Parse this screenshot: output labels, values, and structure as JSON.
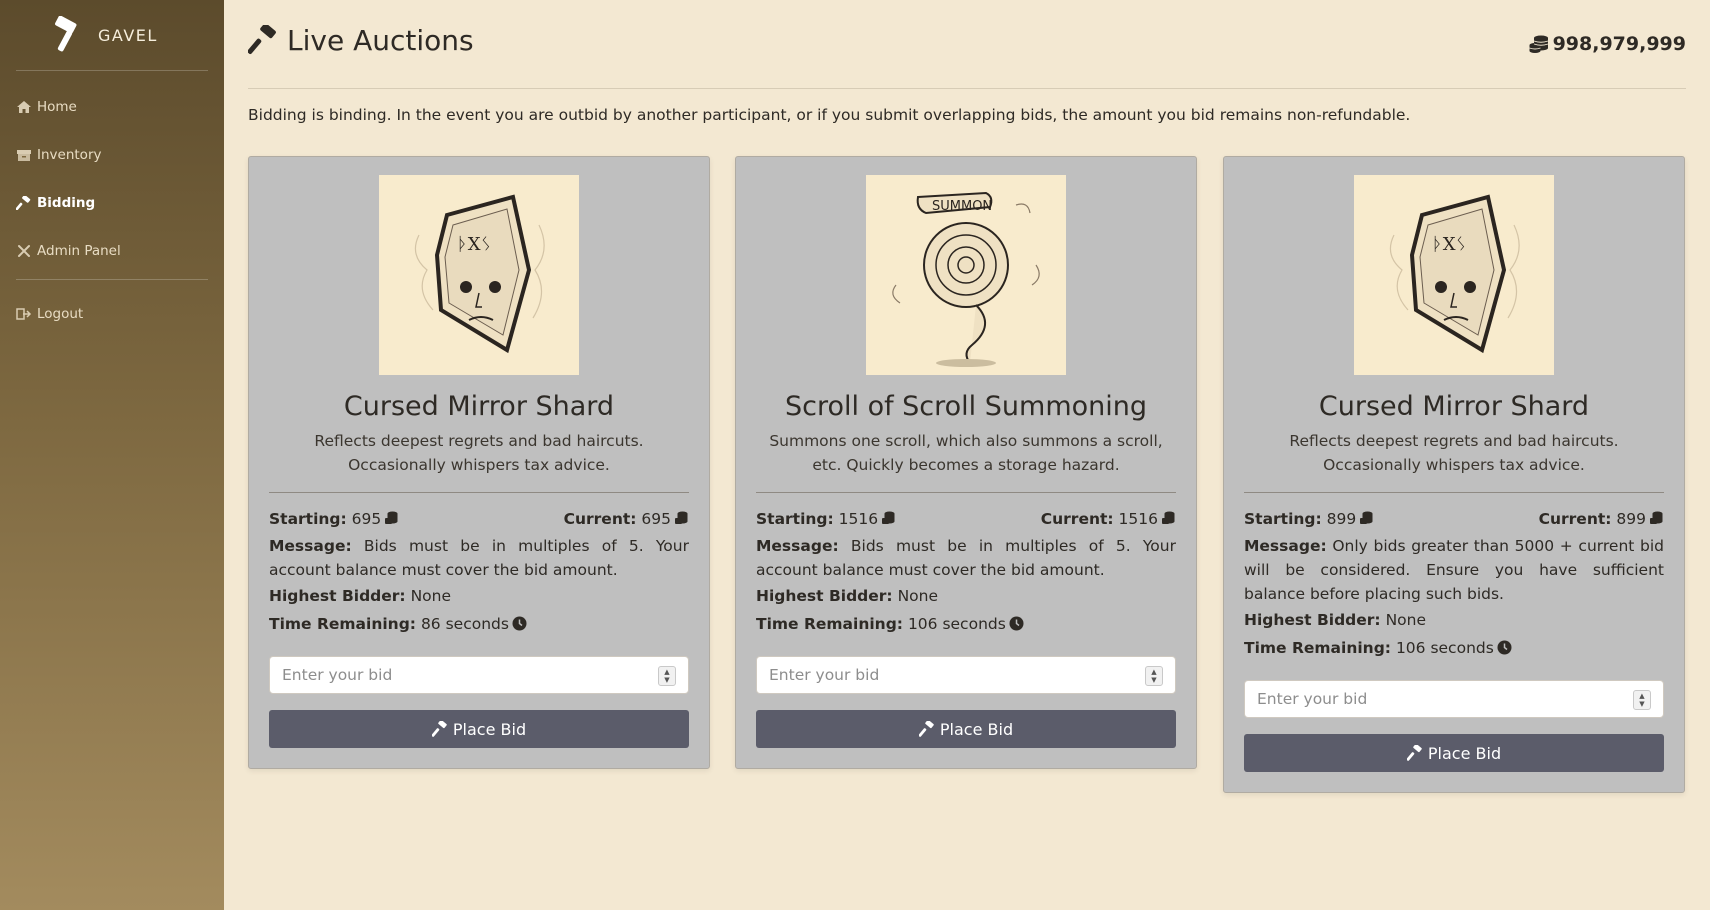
{
  "app": {
    "brand": "GAVEL"
  },
  "sidebar": {
    "items": [
      {
        "label": "Home",
        "icon": "home-icon"
      },
      {
        "label": "Inventory",
        "icon": "inventory-box-icon"
      },
      {
        "label": "Bidding",
        "icon": "gavel-icon",
        "active": true
      },
      {
        "label": "Admin Panel",
        "icon": "tools-icon"
      }
    ],
    "logout": {
      "label": "Logout",
      "icon": "logout-icon"
    }
  },
  "header": {
    "title": "Live Auctions",
    "balance": "998,979,999",
    "balance_icon": "coins-icon"
  },
  "notice": "Bidding is binding. In the event you are outbid by another participant, or if you submit overlapping bids, the amount you bid remains non-refundable.",
  "labels": {
    "starting": "Starting:",
    "current": "Current:",
    "message": "Message:",
    "highest_bidder": "Highest Bidder:",
    "time_remaining": "Time Remaining:",
    "bid_placeholder": "Enter your bid",
    "place_bid": "Place Bid"
  },
  "auctions": [
    {
      "name": "Cursed Mirror Shard",
      "image": "cursed-mirror-shard-illustration",
      "description": "Reflects deepest regrets and bad haircuts. Occasionally whispers tax advice.",
      "starting": "695",
      "current": "695",
      "message": "Bids must be in multiples of 5. Your account balance must cover the bid amount.",
      "highest_bidder": "None",
      "time_remaining": "86 seconds"
    },
    {
      "name": "Scroll of Scroll Summoning",
      "image": "summon-scroll-illustration",
      "description": "Summons one scroll, which also summons a scroll, etc. Quickly becomes a storage hazard.",
      "starting": "1516",
      "current": "1516",
      "message": "Bids must be in multiples of 5. Your account balance must cover the bid amount.",
      "highest_bidder": "None",
      "time_remaining": "106 seconds"
    },
    {
      "name": "Cursed Mirror Shard",
      "image": "cursed-mirror-shard-illustration",
      "description": "Reflects deepest regrets and bad haircuts. Occasionally whispers tax advice.",
      "starting": "899",
      "current": "899",
      "message": "Only bids greater than 5000 + current bid will be considered. Ensure you have sufficient balance before placing such bids.",
      "highest_bidder": "None",
      "time_remaining": "106 seconds"
    }
  ],
  "colors": {
    "page_bg": "#f3e8d2",
    "sidebar_top": "#5c4b2c",
    "sidebar_bottom": "#a38b5e",
    "card_bg": "#bfbfbf",
    "button_bg": "#5b5c6a"
  }
}
